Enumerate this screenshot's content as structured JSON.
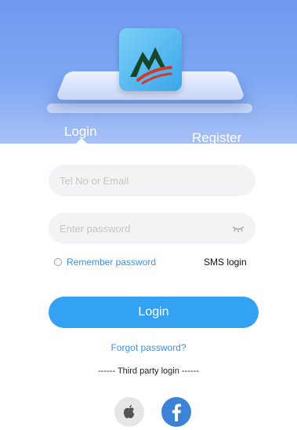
{
  "tabs": {
    "login": "Login",
    "register": "Register"
  },
  "form": {
    "phone_placeholder": "Tel No or Email",
    "password_placeholder": "Enter password",
    "remember_label": "Remember password",
    "sms_login": "SMS login",
    "login_button": "Login",
    "forgot_password": "Forgot password?",
    "third_party": "------ Third party login ------"
  },
  "icons": {
    "logo": "mountain-logo-icon",
    "eye": "eye-closed-icon",
    "apple": "apple-icon",
    "facebook": "facebook-icon"
  },
  "colors": {
    "header": "#7ea7f3",
    "accent": "#34a2f2",
    "link": "#3d8fe6",
    "facebook": "#3c82d6"
  }
}
